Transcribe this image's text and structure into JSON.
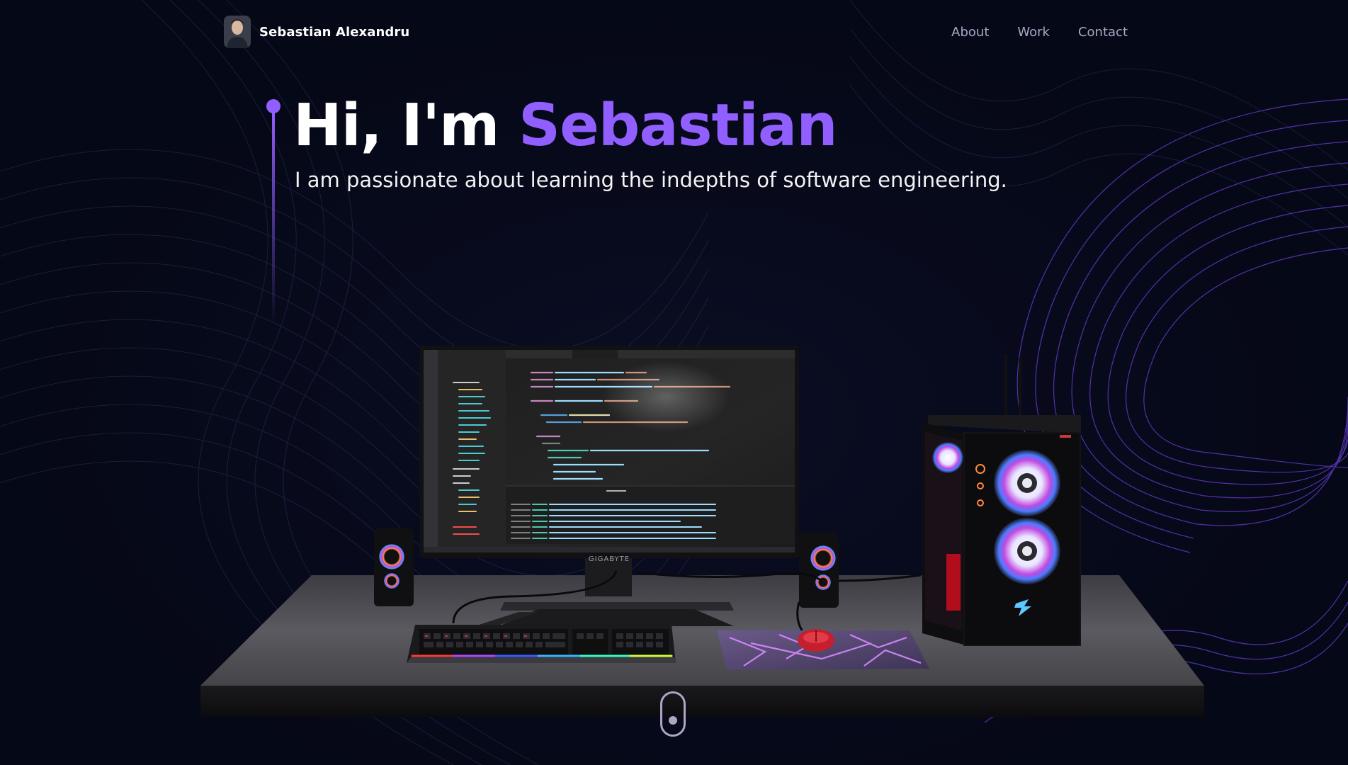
{
  "navbar": {
    "brand_name": "Sebastian Alexandru",
    "links": [
      "About",
      "Work",
      "Contact"
    ]
  },
  "hero": {
    "greeting": "Hi, I'm ",
    "name": "Sebastian",
    "subtitle": "I am passionate about learning the indepths of software engineering."
  },
  "monitor": {
    "brand": "GIGABYTE"
  },
  "colors": {
    "background": "#050816",
    "accent": "#915eff",
    "nav_text": "#aaa6c3",
    "text": "#ffffff"
  },
  "icons": {
    "scroll": "mouse-scroll-icon"
  }
}
